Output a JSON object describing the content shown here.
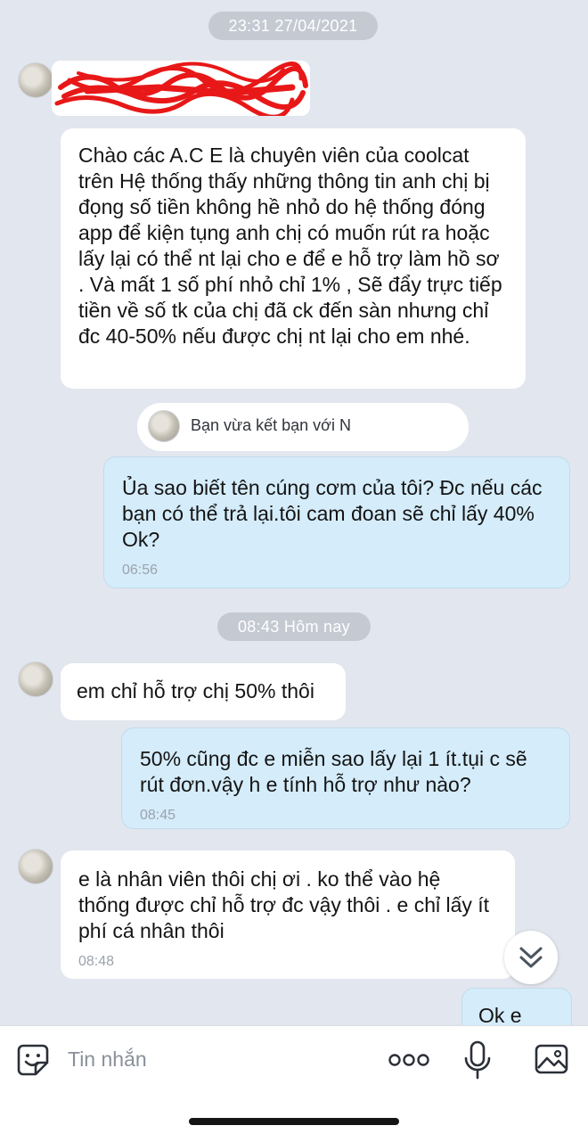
{
  "timestamps": {
    "first": "23:31 27/04/2021",
    "second": "08:43 Hôm nay"
  },
  "messages": [
    {
      "direction": "in",
      "text": "Chào các A.C E là chuyên viên của coolcat trên Hệ thống thấy những thông tin anh chị bị đọng số tiền không hề nhỏ do hệ thống đóng app để kiện tụng anh chị có muốn rút ra hoặc lấy lại  có thể nt lại cho e để e hỗ trợ làm hồ sơ . Và mất 1 số phí nhỏ chỉ 1% , Sẽ đẩy trực tiếp tiền về số tk của chị đã ck đến sàn nhưng chỉ đc 40-50% nếu được chị nt lại cho em nhé.",
      "time": ""
    },
    {
      "direction": "out",
      "text": "Ủa sao biết tên cúng cơm của tôi? Đc nếu các bạn có thể trả lại.tôi cam đoan sẽ chỉ lấy 40% Ok?",
      "time": "06:56"
    },
    {
      "direction": "in",
      "text": "em chỉ hỗ trợ chị 50% thôi",
      "time": ""
    },
    {
      "direction": "out",
      "text": "50% cũng đc e miễn sao lấy lại 1 ít.tụi c sẽ rút đơn.vậy h e tính hỗ trợ như nào?",
      "time": "08:45"
    },
    {
      "direction": "in",
      "text": "e là nhân viên thôi chị ơi . ko thể vào hệ thống được chỉ hỗ trợ đc vậy thôi . e chỉ lấy ít phí cá nhân thôi",
      "time": "08:48"
    },
    {
      "direction": "out",
      "text": "Ok e",
      "time": ""
    }
  ],
  "friend_notice": "Bạn vừa kết bạn với N",
  "input": {
    "placeholder": "Tin nhắn"
  },
  "icons": {
    "emoji": "sticker-smile-icon",
    "more": "more-dots-icon",
    "mic": "microphone-icon",
    "image": "image-gallery-icon",
    "scroll": "double-chevron-down-icon"
  },
  "colors": {
    "chat_background": "#e2e6ee",
    "outgoing_bubble": "#d5ecfa",
    "incoming_bubble": "#ffffff",
    "redaction_scribble": "#e81818"
  }
}
